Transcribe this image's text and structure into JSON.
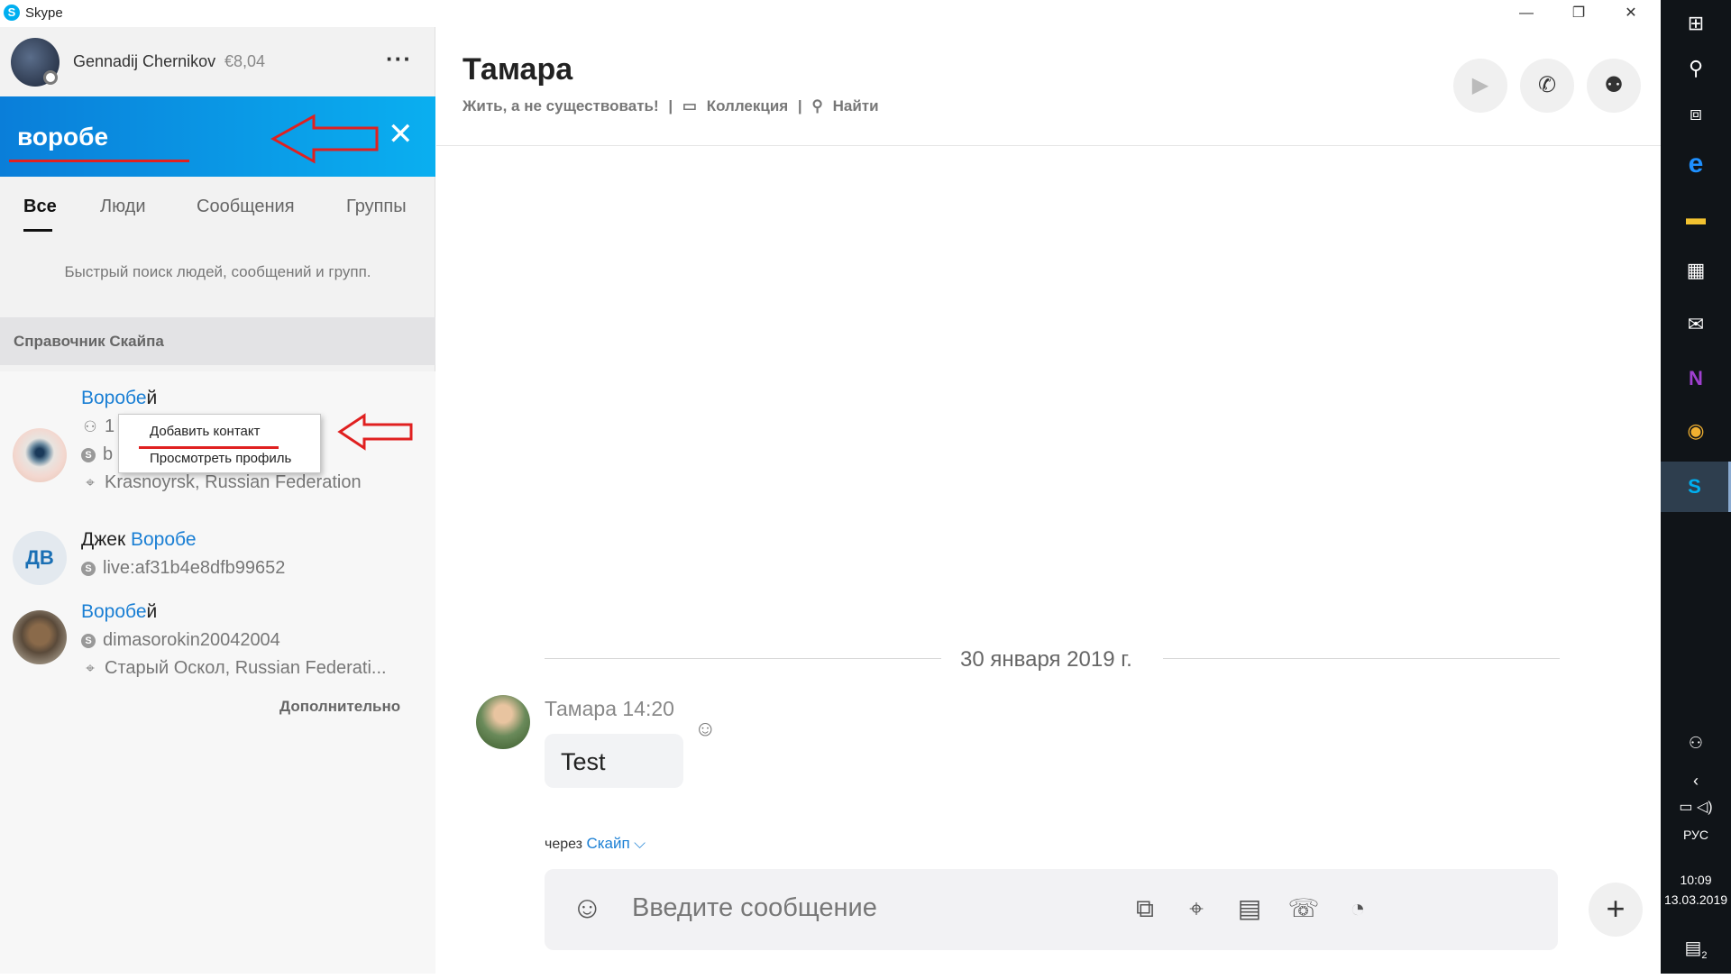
{
  "window": {
    "app_title": "Skype",
    "minimize": "—",
    "restore": "❐",
    "close": "✕"
  },
  "profile": {
    "name": "Gennadij Chernikov",
    "credit": "€8,04",
    "more": "···"
  },
  "search": {
    "value": "воробе",
    "clear": "✕"
  },
  "tabs": [
    "Все",
    "Люди",
    "Сообщения",
    "Группы"
  ],
  "hint": "Быстрый поиск людей, сообщений и групп.",
  "directory": {
    "header": "Справочник Скайпа",
    "results": [
      {
        "name_hl": "Воробе",
        "name_rest": "й",
        "line1": "1",
        "line2": "b",
        "location": "Krasnoyrsk, Russian Federation"
      },
      {
        "name_pre": "Джек ",
        "name_hl": "Воробе",
        "initials": "ДВ",
        "skype_id": "live:af31b4e8dfb99652"
      },
      {
        "name_hl": "Воробе",
        "name_rest": "й",
        "skype_id": "dimasorokin20042004",
        "location": "Старый Оскол, Russian Federati..."
      }
    ],
    "more": "Дополнительно"
  },
  "context_menu": {
    "add": "Добавить контакт",
    "view": "Просмотреть профиль"
  },
  "chat": {
    "title": "Тамара",
    "mood": "Жить, а не существовать!",
    "separator": "|",
    "collection": "Коллекция",
    "find": "Найти",
    "date": "30 января 2019 г.",
    "message": {
      "author_time": "Тамара 14:20",
      "text": "Test"
    },
    "via_prefix": "через",
    "via_link": "Скайп",
    "composer_placeholder": "Введите сообщение"
  },
  "taskbar": {
    "lang": "РУС",
    "time": "10:09",
    "date": "13.03.2019",
    "notif_count": "2"
  },
  "colors": {
    "accent": "#00aff0",
    "search_gradient_start": "#0a7ed9",
    "link": "#1a7fd4",
    "annotation_red": "#e02020"
  }
}
